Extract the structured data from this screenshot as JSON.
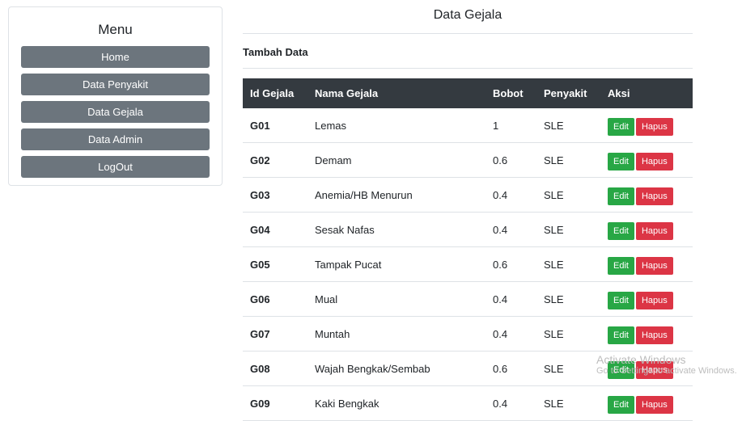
{
  "sidebar": {
    "title": "Menu",
    "items": [
      {
        "label": "Home"
      },
      {
        "label": "Data Penyakit"
      },
      {
        "label": "Data Gejala"
      },
      {
        "label": "Data Admin"
      },
      {
        "label": "LogOut"
      }
    ]
  },
  "main": {
    "title": "Data Gejala",
    "add_link": "Tambah Data",
    "table": {
      "headers": [
        "Id Gejala",
        "Nama Gejala",
        "Bobot",
        "Penyakit",
        "Aksi"
      ],
      "rows": [
        {
          "id": "G01",
          "name": "Lemas",
          "bobot": "1",
          "penyakit": "SLE"
        },
        {
          "id": "G02",
          "name": "Demam",
          "bobot": "0.6",
          "penyakit": "SLE"
        },
        {
          "id": "G03",
          "name": "Anemia/HB Menurun",
          "bobot": "0.4",
          "penyakit": "SLE"
        },
        {
          "id": "G04",
          "name": "Sesak Nafas",
          "bobot": "0.4",
          "penyakit": "SLE"
        },
        {
          "id": "G05",
          "name": "Tampak Pucat",
          "bobot": "0.6",
          "penyakit": "SLE"
        },
        {
          "id": "G06",
          "name": "Mual",
          "bobot": "0.4",
          "penyakit": "SLE"
        },
        {
          "id": "G07",
          "name": "Muntah",
          "bobot": "0.4",
          "penyakit": "SLE"
        },
        {
          "id": "G08",
          "name": "Wajah Bengkak/Sembab",
          "bobot": "0.6",
          "penyakit": "SLE"
        },
        {
          "id": "G09",
          "name": "Kaki Bengkak",
          "bobot": "0.4",
          "penyakit": "SLE"
        }
      ],
      "edit_label": "Edit",
      "delete_label": "Hapus"
    }
  },
  "watermark": {
    "line1": "Activate Windows",
    "line2": "Go to Settings to activate Windows."
  },
  "colors": {
    "menu_button": "#6c757d",
    "table_header": "#343a40",
    "edit_button": "#28a745",
    "delete_button": "#dc3545"
  }
}
